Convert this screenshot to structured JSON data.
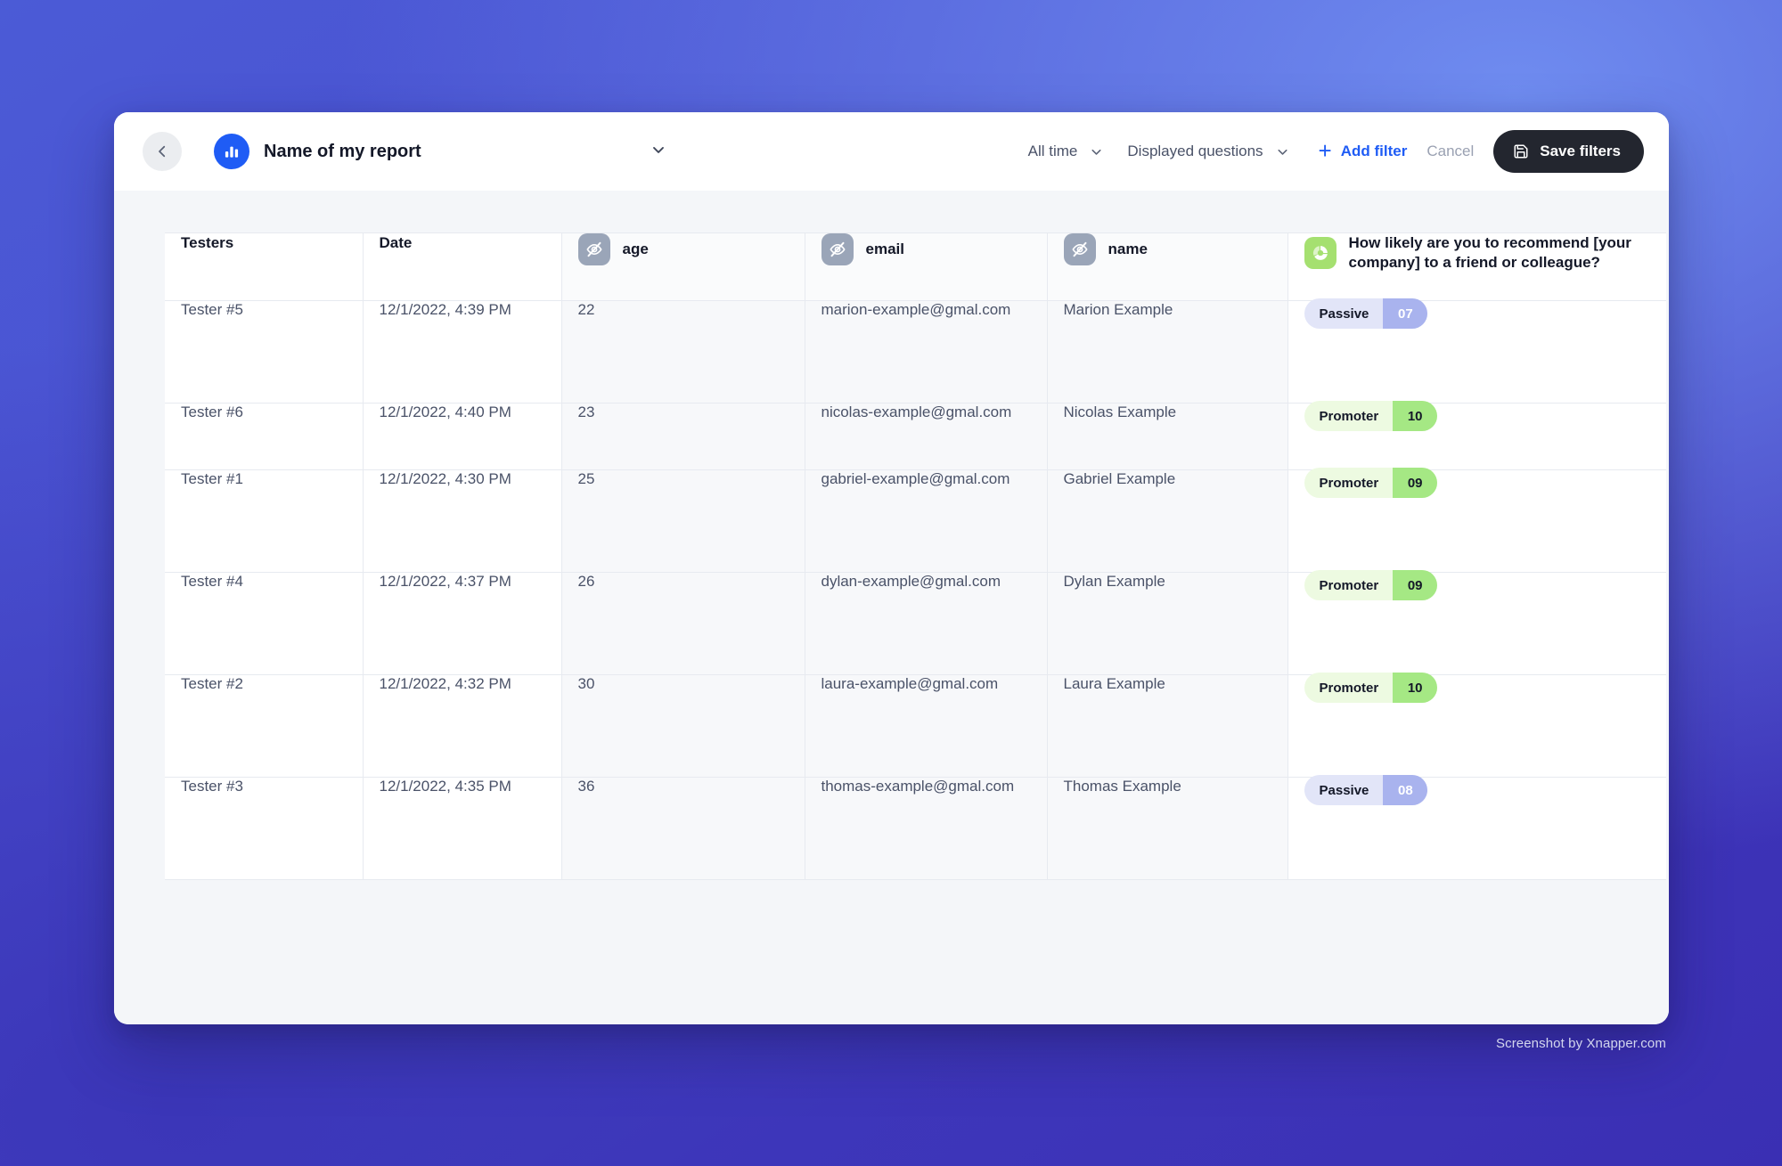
{
  "header": {
    "back_icon": "chevron-left-icon",
    "report_icon": "bar-chart-icon",
    "report_title": "Name of my report",
    "title_chevron_icon": "chevron-down-icon",
    "date_filter": {
      "label": "All time",
      "icon": "chevron-down-icon"
    },
    "question_filter": {
      "label": "Displayed questions",
      "icon": "chevron-down-icon"
    },
    "add_filter": {
      "label": "Add filter",
      "icon": "plus-icon"
    },
    "cancel_label": "Cancel",
    "save_filters": {
      "label": "Save filters",
      "icon": "save-disk-icon"
    }
  },
  "table": {
    "columns": [
      {
        "label": "Testers",
        "icon": null,
        "tinted": false
      },
      {
        "label": "Date",
        "icon": null,
        "tinted": false
      },
      {
        "label": "age",
        "icon": "eye-off-icon",
        "icon_color": "grey",
        "tinted": true
      },
      {
        "label": "email",
        "icon": "eye-off-icon",
        "icon_color": "grey",
        "tinted": true
      },
      {
        "label": "name",
        "icon": "eye-off-icon",
        "icon_color": "grey",
        "tinted": true
      },
      {
        "label": "How likely are you to recommend [your company] to a friend or colleague?",
        "icon": "donut-chart-icon",
        "icon_color": "green",
        "tinted": false
      }
    ],
    "rows": [
      {
        "tester": "Tester #5",
        "date": "12/1/2022, 4:39 PM",
        "age": "22",
        "email": "marion-example@gmal.com",
        "name": "Marion Example",
        "nps": {
          "label": "Passive",
          "score": "07",
          "type": "passive"
        },
        "height": "tall"
      },
      {
        "tester": "Tester #6",
        "date": "12/1/2022, 4:40 PM",
        "age": "23",
        "email": "nicolas-example@gmal.com",
        "name": "Nicolas Example",
        "nps": {
          "label": "Promoter",
          "score": "10",
          "type": "promoter"
        },
        "height": "short"
      },
      {
        "tester": "Tester #1",
        "date": "12/1/2022, 4:30 PM",
        "age": "25",
        "email": "gabriel-example@gmal.com",
        "name": "Gabriel Example",
        "nps": {
          "label": "Promoter",
          "score": "09",
          "type": "promoter"
        },
        "height": "tall"
      },
      {
        "tester": "Tester #4",
        "date": "12/1/2022, 4:37 PM",
        "age": "26",
        "email": "dylan-example@gmal.com",
        "name": "Dylan Example",
        "nps": {
          "label": "Promoter",
          "score": "09",
          "type": "promoter"
        },
        "height": "tall"
      },
      {
        "tester": "Tester #2",
        "date": "12/1/2022, 4:32 PM",
        "age": "30",
        "email": "laura-example@gmal.com",
        "name": "Laura Example",
        "nps": {
          "label": "Promoter",
          "score": "10",
          "type": "promoter"
        },
        "height": "tall"
      },
      {
        "tester": "Tester #3",
        "date": "12/1/2022, 4:35 PM",
        "age": "36",
        "email": "thomas-example@gmal.com",
        "name": "Thomas Example",
        "nps": {
          "label": "Passive",
          "score": "08",
          "type": "passive"
        },
        "height": "tall"
      }
    ]
  },
  "watermark": "Screenshot by Xnapper.com",
  "colors": {
    "accent_blue": "#1f5cf5",
    "dark_button": "#23262f",
    "promoter_bg": "#edfae1",
    "promoter_score": "#a5e884",
    "passive_bg": "#e2e5f8",
    "passive_score": "#a9b3ee",
    "icon_grey": "#9aa5b8",
    "icon_green": "#a5e070"
  }
}
